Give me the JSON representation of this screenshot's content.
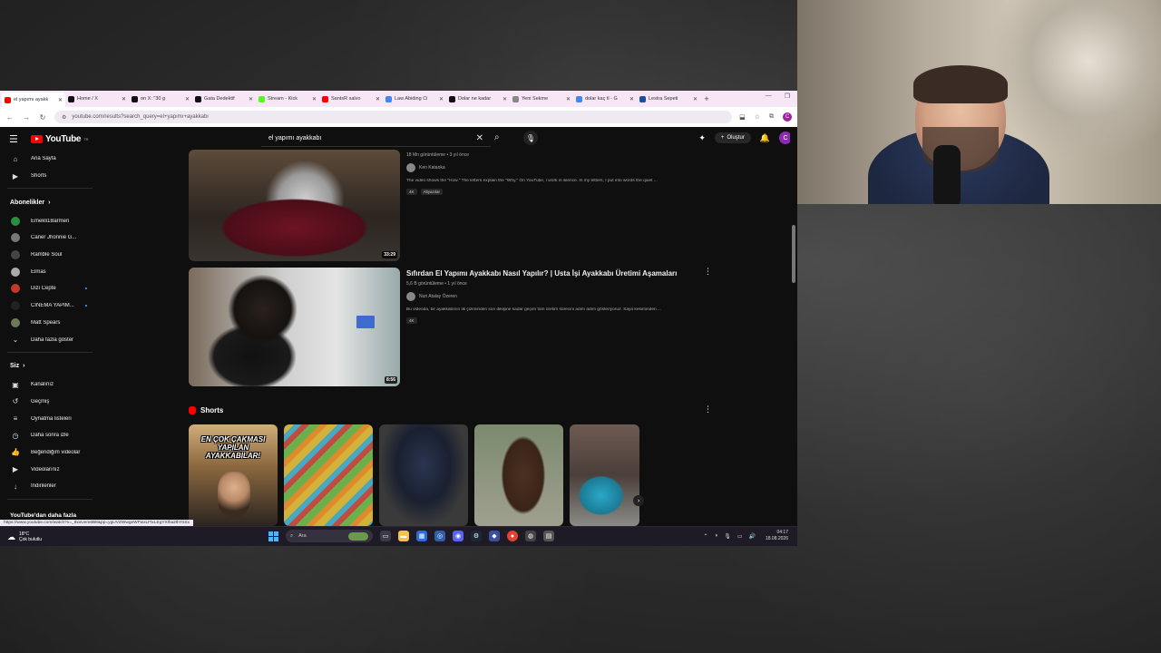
{
  "browser": {
    "tabs": [
      {
        "label": "el yapımı ayakk",
        "color": "#ff0000",
        "active": true
      },
      {
        "label": "Home / X",
        "color": "#111111"
      },
      {
        "label": "on X: \"30 g",
        "color": "#111111"
      },
      {
        "label": "Gata Dedektif",
        "color": "#111111"
      },
      {
        "label": "Stream - Kick",
        "color": "#53fc18"
      },
      {
        "label": "SantsR salvo",
        "color": "#ff0000"
      },
      {
        "label": "Law Abiding Ci",
        "color": "#4285f4"
      },
      {
        "label": "Dolar ne kadar",
        "color": "#111111"
      },
      {
        "label": "Yeni Sekme",
        "color": "#888888"
      },
      {
        "label": "dolar kaç tl - G",
        "color": "#4285f4"
      },
      {
        "label": "Lestra Sepeti",
        "color": "#1a4fa0"
      }
    ],
    "tab_new": "+",
    "url": "youtube.com/results?search_query=el+yapımı+ayakkabı"
  },
  "youtube": {
    "logo_text": "YouTube",
    "logo_country": "TR",
    "search_value": "el yapımı ayakkabı",
    "create_label": "Oluştur",
    "avatar_letter": "C",
    "sidebar": {
      "top": [
        {
          "icon": "⌂",
          "label": "Ana Sayfa",
          "name": "home"
        },
        {
          "icon": "▶",
          "label": "Shorts",
          "name": "shorts"
        }
      ],
      "subs_title": "Abonelikler",
      "subs": [
        {
          "label": "Emekli1Barmen",
          "color": "#2a8f3c"
        },
        {
          "label": "Caner Jhonnie G...",
          "color": "#777777"
        },
        {
          "label": "Ramble Soul",
          "color": "#444444"
        },
        {
          "label": "Elmas",
          "color": "#aaaaaa"
        },
        {
          "label": "Dizi Cepte",
          "color": "#c0392b",
          "live": true
        },
        {
          "label": "CİNEMA YAPIM...",
          "color": "#222222",
          "live": true
        },
        {
          "label": "Matt Spears",
          "color": "#6d7a5a"
        }
      ],
      "show_more": "Daha fazla göster",
      "you_title": "Siz",
      "you_items": [
        {
          "icon": "▣",
          "label": "Kanalınız",
          "name": "your-channel"
        },
        {
          "icon": "↺",
          "label": "Geçmiş",
          "name": "history"
        },
        {
          "icon": "≡",
          "label": "Oynatma listeleri",
          "name": "playlists"
        },
        {
          "icon": "◷",
          "label": "Daha sonra izle",
          "name": "watch-later"
        },
        {
          "icon": "👍",
          "label": "Beğendiğim videolar",
          "name": "liked-videos"
        },
        {
          "icon": "▶",
          "label": "Videolarınız",
          "name": "your-videos"
        },
        {
          "icon": "↓",
          "label": "İndirilenler",
          "name": "downloads"
        }
      ],
      "more_from": "YouTube'dan daha fazla"
    },
    "videos": [
      {
        "title": "",
        "meta": "18 Mn görüntüleme • 3 yıl önce",
        "channel": "Ken Kataoka",
        "desc": "The video shows the \"How.\" The letters explain the \"Why.\" On YouTube, I work in silence. In my letters, I put into words the quiet ...",
        "badges": [
          "4K",
          "Altyazılar"
        ],
        "duration": "33:29"
      },
      {
        "title": "Sıfırdan El Yapımı Ayakkabı Nasıl Yapılır? | Usta İşi Ayakkabı Üretimi Aşamaları",
        "meta": "5,6 B görüntüleme • 1 yıl önce",
        "channel": "Nuri Atalay Özeren",
        "desc": "Bu videoda, bir ayakkabının ilk çiziminden son dikişine kadar geçen tüm üretim sürecini adım adım gösteriyoruz. Saya kesiminden ...",
        "badges": [
          "4K"
        ],
        "duration": "8:56"
      }
    ],
    "shorts_title": "Shorts",
    "shorts_first_text": "EN ÇOK ÇAKMASI YAPILAN AYAKKABILAR!",
    "status_url": "https://www.youtube.com/watch?v=_8xxUem6B8&pp=ygUVZWwgeWFwxLFtxLEgYXlha2thYsSx"
  },
  "taskbar": {
    "temp": "18°C",
    "weather": "Çok bulutlu",
    "search_placeholder": "Ara",
    "time": "04:17",
    "date": "18.08.2026"
  }
}
